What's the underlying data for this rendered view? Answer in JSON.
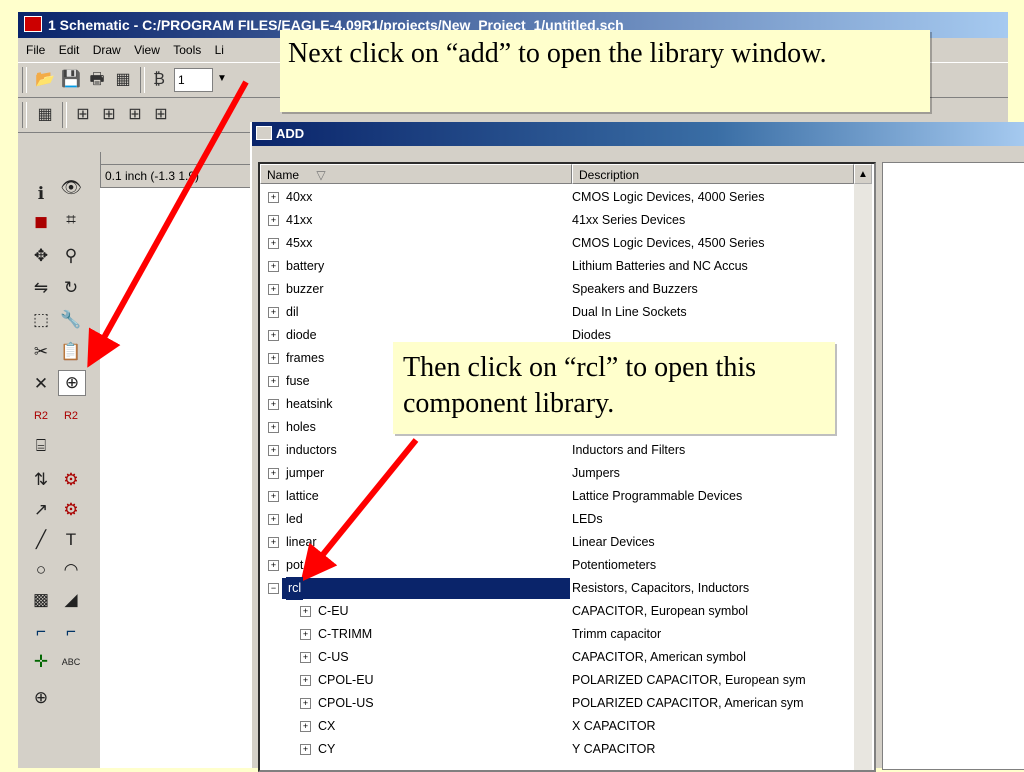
{
  "window": {
    "title": "1 Schematic - C:/PROGRAM FILES/EAGLE-4.09R1/projects/New_Project_1/untitled.sch"
  },
  "menu": [
    "File",
    "Edit",
    "Draw",
    "View",
    "Tools",
    "Li"
  ],
  "toolbar": {
    "grid_value": "1"
  },
  "status": {
    "coords": "0.1 inch (-1.3 1.9)"
  },
  "dialog": {
    "title": "ADD",
    "columns": {
      "name": "Name",
      "description": "Description",
      "sort_glyph": "▽"
    },
    "rows": [
      {
        "name": "40xx",
        "description": "CMOS Logic Devices, 4000 Series",
        "level": 0,
        "expander": "+"
      },
      {
        "name": "41xx",
        "description": "41xx Series Devices",
        "level": 0,
        "expander": "+"
      },
      {
        "name": "45xx",
        "description": "CMOS Logic Devices, 4500 Series",
        "level": 0,
        "expander": "+"
      },
      {
        "name": "battery",
        "description": "Lithium Batteries and NC Accus",
        "level": 0,
        "expander": "+"
      },
      {
        "name": "buzzer",
        "description": "Speakers and Buzzers",
        "level": 0,
        "expander": "+"
      },
      {
        "name": "dil",
        "description": "Dual In Line Sockets",
        "level": 0,
        "expander": "+"
      },
      {
        "name": "diode",
        "description": "Diodes",
        "level": 0,
        "expander": "+"
      },
      {
        "name": "frames",
        "description": "",
        "level": 0,
        "expander": "+"
      },
      {
        "name": "fuse",
        "description": "",
        "level": 0,
        "expander": "+"
      },
      {
        "name": "heatsink",
        "description": "",
        "level": 0,
        "expander": "+"
      },
      {
        "name": "holes",
        "description": "",
        "level": 0,
        "expander": "+"
      },
      {
        "name": "inductors",
        "description": "Inductors and Filters",
        "level": 0,
        "expander": "+"
      },
      {
        "name": "jumper",
        "description": "Jumpers",
        "level": 0,
        "expander": "+"
      },
      {
        "name": "lattice",
        "description": "Lattice Programmable Devices",
        "level": 0,
        "expander": "+"
      },
      {
        "name": "led",
        "description": "LEDs",
        "level": 0,
        "expander": "+"
      },
      {
        "name": "linear",
        "description": "Linear Devices",
        "level": 0,
        "expander": "+"
      },
      {
        "name": "pot",
        "description": "Potentiometers",
        "level": 0,
        "expander": "+"
      },
      {
        "name": "rcl",
        "description": "Resistors, Capacitors, Inductors",
        "level": 0,
        "expander": "−"
      },
      {
        "name": "C-EU",
        "description": "CAPACITOR, European symbol",
        "level": 1,
        "expander": "+"
      },
      {
        "name": "C-TRIMM",
        "description": "Trimm capacitor",
        "level": 1,
        "expander": "+"
      },
      {
        "name": "C-US",
        "description": "CAPACITOR, American symbol",
        "level": 1,
        "expander": "+"
      },
      {
        "name": "CPOL-EU",
        "description": "POLARIZED CAPACITOR, European sym",
        "level": 1,
        "expander": "+"
      },
      {
        "name": "CPOL-US",
        "description": "POLARIZED CAPACITOR, American sym",
        "level": 1,
        "expander": "+"
      },
      {
        "name": "CX",
        "description": "X CAPACITOR",
        "level": 1,
        "expander": "+"
      },
      {
        "name": "CY",
        "description": "Y CAPACITOR",
        "level": 1,
        "expander": "+"
      }
    ],
    "selected": "rcl"
  },
  "callouts": {
    "first": "Next click on “add” to open the library window.",
    "second": "Then click on “rcl” to open this component library."
  },
  "colors": {
    "background": "#ffffcc",
    "arrow": "#ff0000",
    "selection": "#0a246a"
  }
}
